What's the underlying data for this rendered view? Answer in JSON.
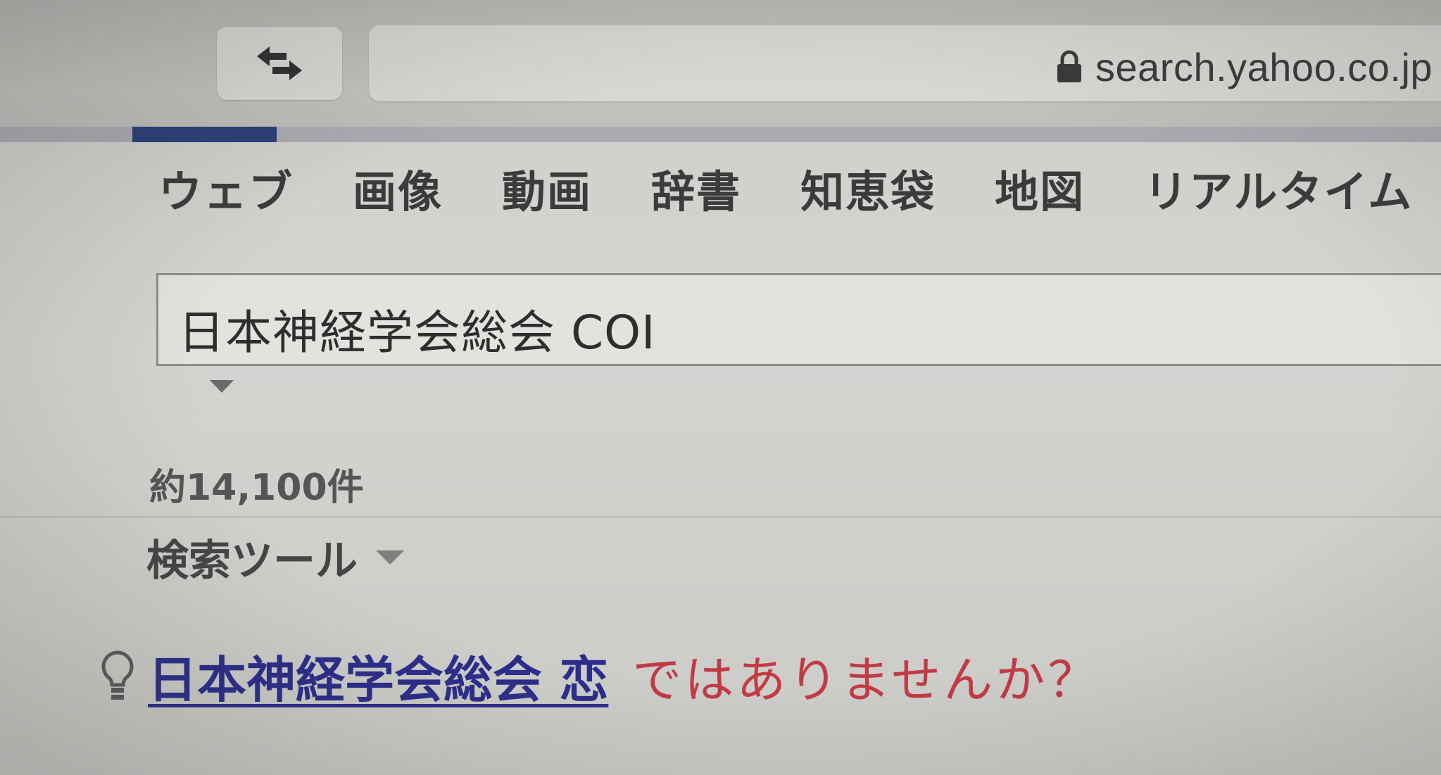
{
  "browser": {
    "url": "search.yahoo.co.jp",
    "tab_switch_icon": "tab-switch-icon",
    "lock_icon": "lock-icon",
    "progress": 0.1
  },
  "vertical_tabs": [
    {
      "label": "ウェブ"
    },
    {
      "label": "画像"
    },
    {
      "label": "動画"
    },
    {
      "label": "辞書"
    },
    {
      "label": "知恵袋"
    },
    {
      "label": "地図"
    },
    {
      "label": "リアルタイム"
    },
    {
      "label": "・"
    }
  ],
  "search": {
    "query": "日本神経学会総会 COI"
  },
  "results": {
    "count_text": "約14,100件",
    "search_tools_label": "検索ツール"
  },
  "suggestion": {
    "icon": "lightbulb-icon",
    "link_text": "日本神経学会総会 恋",
    "rest_text": "ではありませんか？",
    "link_color": "#2b2d8a",
    "text_color": "#c23a44"
  }
}
